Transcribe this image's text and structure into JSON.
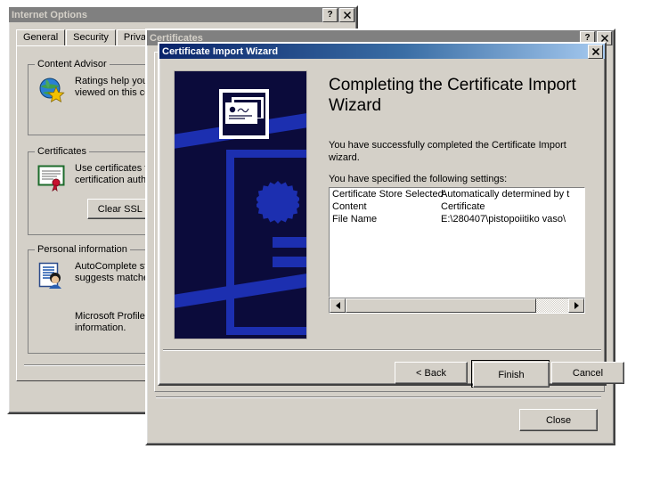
{
  "internet_options": {
    "title": "Internet Options",
    "help_button": "?",
    "close_button": "✕",
    "tabs": [
      {
        "label": "General"
      },
      {
        "label": "Security"
      },
      {
        "label": "Privacy"
      }
    ],
    "groups": [
      {
        "legend": "Content Advisor",
        "icon": "globe-star-icon",
        "text": "Ratings help you control the Internet content that can be viewed on this computer."
      },
      {
        "legend": "Certificates",
        "icon": "certificate-ribbon-icon",
        "text": "Use certificates to positively identify yourself, certification authorities, and publishers.",
        "button": "Clear SSL State"
      },
      {
        "legend": "Personal information",
        "icon": "autocomplete-form-icon",
        "text_1": "AutoComplete stores previous entries on webpages and suggests matches for you.",
        "text_2": "Microsoft Profile Assistant stores your personal information."
      }
    ]
  },
  "certificates_window": {
    "title": "Certificates",
    "help_button": "?",
    "close_button": "✕",
    "close_label": "Close"
  },
  "wizard": {
    "title": "Certificate Import Wizard",
    "close_button": "✕",
    "heading": "Completing the Certificate Import Wizard",
    "paragraph": "You have successfully completed the Certificate Import wizard.",
    "settings_intro": "You have specified the following settings:",
    "settings": [
      {
        "name": "Certificate Store Selected",
        "value": "Automatically determined by t"
      },
      {
        "name": "Content",
        "value": "Certificate"
      },
      {
        "name": "File Name",
        "value": "E:\\280407\\pistopoiitiko vaso\\"
      }
    ],
    "buttons": {
      "back": "< Back",
      "finish": "Finish",
      "cancel": "Cancel"
    },
    "watermark_icon": "certificate-pages-icon"
  },
  "colors": {
    "face": "#d4d0c8",
    "title_active_start": "#0a246a",
    "title_active_end": "#a6caf0",
    "title_inactive": "#808080",
    "watermark_bg": "#0b0b3b",
    "watermark_accent": "#1c2fb0"
  }
}
